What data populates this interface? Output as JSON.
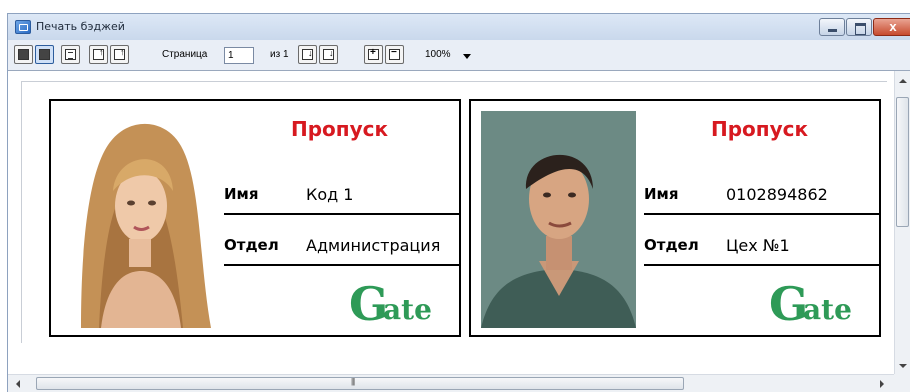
{
  "window": {
    "title": "Печать бэджей",
    "close_glyph": "x"
  },
  "toolbar": {
    "page_label": "Страница",
    "page_value": "1",
    "of_label": "из 1",
    "zoom_value": "100%"
  },
  "badges": [
    {
      "title": "Пропуск",
      "name_label": "Имя",
      "name_value": "Код 1",
      "dept_label": "Отдел",
      "dept_value": "Администрация",
      "logo_first": "G",
      "logo_rest": "ate"
    },
    {
      "title": "Пропуск",
      "name_label": "Имя",
      "name_value": "0102894862",
      "dept_label": "Отдел",
      "dept_value": "Цех №1",
      "logo_first": "G",
      "logo_rest": "ate"
    }
  ],
  "colors": {
    "title_red": "#d71920",
    "logo_green": "#2e9a57",
    "chrome_blue": "#e9eef6"
  }
}
